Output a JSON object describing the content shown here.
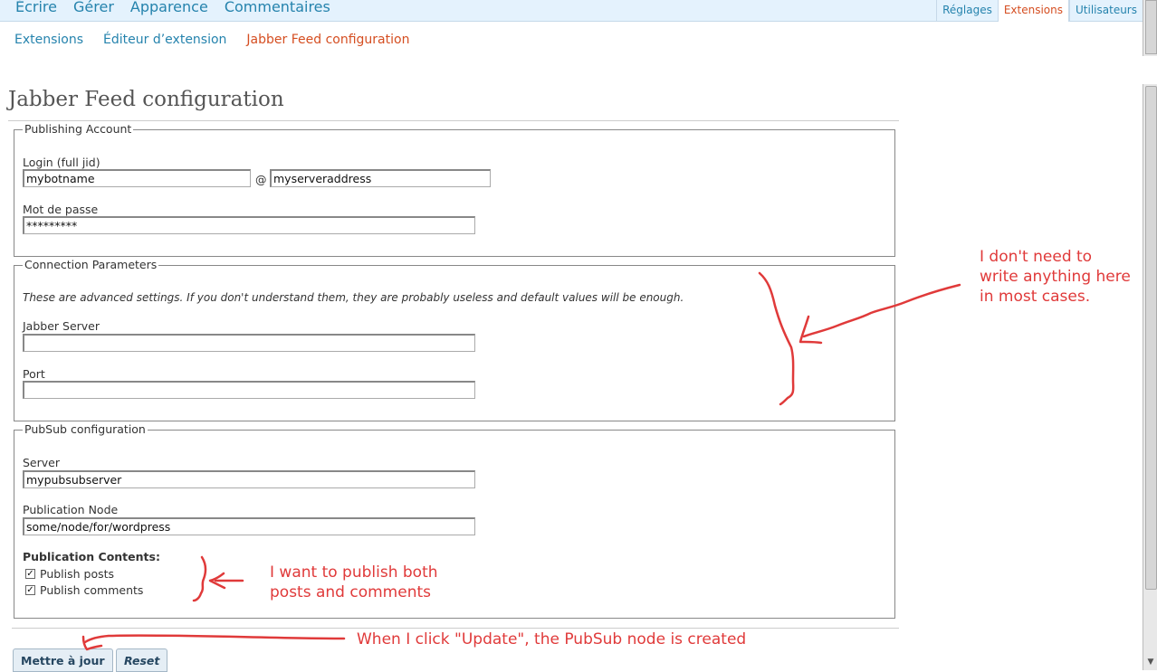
{
  "menu": {
    "main": [
      "Écrire",
      "Gérer",
      "Apparence",
      "Commentaires"
    ],
    "right": [
      "Réglages",
      "Extensions",
      "Utilisateurs"
    ],
    "right_current": "Extensions"
  },
  "submenu": {
    "items": [
      "Extensions",
      "Éditeur d’extension",
      "Jabber Feed configuration"
    ],
    "current": "Jabber Feed configuration"
  },
  "page": {
    "title": "Jabber Feed configuration"
  },
  "publishing": {
    "legend": "Publishing Account",
    "login_label": "Login (full jid)",
    "login_user": "mybotname",
    "at": "@",
    "login_server": "myserveraddress",
    "password_label": "Mot de passe",
    "password_value": "*********"
  },
  "connection": {
    "legend": "Connection Parameters",
    "note": "These are advanced settings. If you don't understand them, they are probably useless and default values will be enough.",
    "server_label": "Jabber Server",
    "server_value": "",
    "port_label": "Port",
    "port_value": ""
  },
  "pubsub": {
    "legend": "PubSub configuration",
    "server_label": "Server",
    "server_value": "mypubsubserver",
    "node_label": "Publication Node",
    "node_value": "some/node/for/wordpress",
    "contents_label": "Publication Contents:",
    "publish_posts": "Publish posts",
    "publish_comments": "Publish comments",
    "posts_checked": true,
    "comments_checked": true
  },
  "buttons": {
    "update": "Mettre à jour",
    "reset": "Reset"
  },
  "annotations": {
    "connection": [
      "I don't need to",
      "write anything here",
      "in most cases."
    ],
    "contents": [
      "I want to publish both",
      "posts and comments"
    ],
    "update": "When I click \"Update\", the PubSub node is created"
  },
  "colors": {
    "annotation": "#e03a3a",
    "link": "#2583ad",
    "current": "#d54e21",
    "topbar": "#e4f2fd"
  }
}
